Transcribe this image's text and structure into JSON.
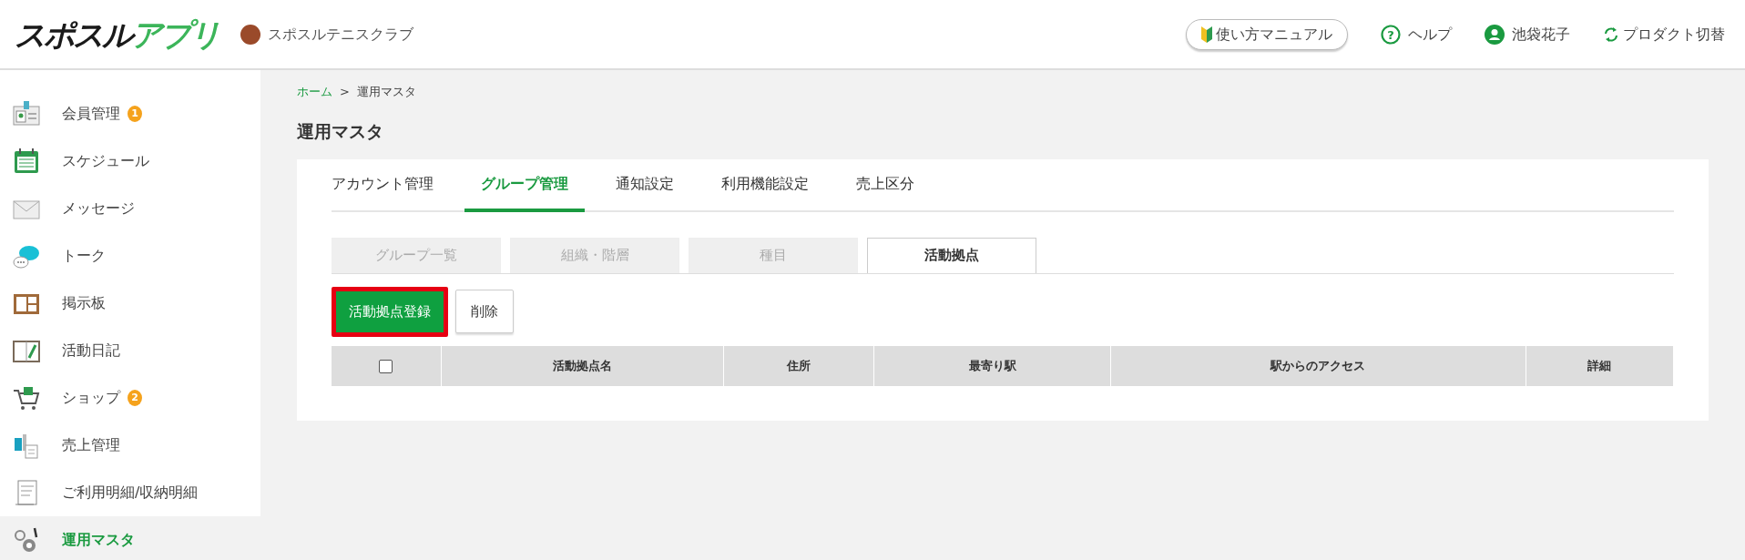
{
  "header": {
    "logo": {
      "main": "スポスル",
      "accent": "アプリ"
    },
    "club": {
      "name": "スポスルテニスクラブ"
    },
    "actions": [
      {
        "kind": "manual",
        "label": "使い方マニュアル"
      },
      {
        "kind": "help",
        "icon": "?",
        "label": "ヘルプ"
      },
      {
        "kind": "user",
        "label": "池袋花子"
      },
      {
        "kind": "switch",
        "label": "プロダクト切替"
      }
    ]
  },
  "sidebar": {
    "items": [
      {
        "kind": "card",
        "label": "会員管理",
        "badge": "1",
        "selected": false
      },
      {
        "kind": "calendar",
        "label": "スケジュール",
        "selected": false
      },
      {
        "kind": "mail",
        "label": "メッセージ",
        "selected": false
      },
      {
        "kind": "chat",
        "label": "トーク",
        "selected": false
      },
      {
        "kind": "board",
        "label": "掲示板",
        "selected": false
      },
      {
        "kind": "diary",
        "label": "活動日記",
        "selected": false
      },
      {
        "kind": "cart",
        "label": "ショップ",
        "badge": "2",
        "selected": false
      },
      {
        "kind": "sales",
        "label": "売上管理",
        "selected": false
      },
      {
        "kind": "receipt",
        "label": "ご利用明細/収納明細",
        "selected": false
      },
      {
        "kind": "gear",
        "label": "運用マスタ",
        "selected": true
      }
    ]
  },
  "breadcrumb": [
    {
      "label": "ホーム",
      "link": true
    },
    {
      "label": ">",
      "link": false
    },
    {
      "label": "運用マスタ",
      "link": false
    }
  ],
  "page_title": "運用マスタ",
  "tabs": [
    {
      "label": "アカウント管理",
      "selected": false
    },
    {
      "label": "グループ管理",
      "selected": true
    },
    {
      "label": "通知設定",
      "selected": false
    },
    {
      "label": "利用機能設定",
      "selected": false
    },
    {
      "label": "売上区分",
      "selected": false
    }
  ],
  "subtabs": [
    {
      "label": "グループ一覧",
      "selected": false
    },
    {
      "label": "組織・階層",
      "selected": false
    },
    {
      "label": "種目",
      "selected": false
    },
    {
      "label": "活動拠点",
      "selected": true
    }
  ],
  "buttons": [
    {
      "kind": "primary",
      "label": "活動拠点登録",
      "highlighted": true
    },
    {
      "kind": "secondary",
      "label": "削除",
      "highlighted": false
    }
  ],
  "table": {
    "select_all": {
      "checked": false
    },
    "columns": [
      "活動拠点名",
      "住所",
      "最寄り駅",
      "駅からのアクセス",
      "詳細"
    ]
  }
}
